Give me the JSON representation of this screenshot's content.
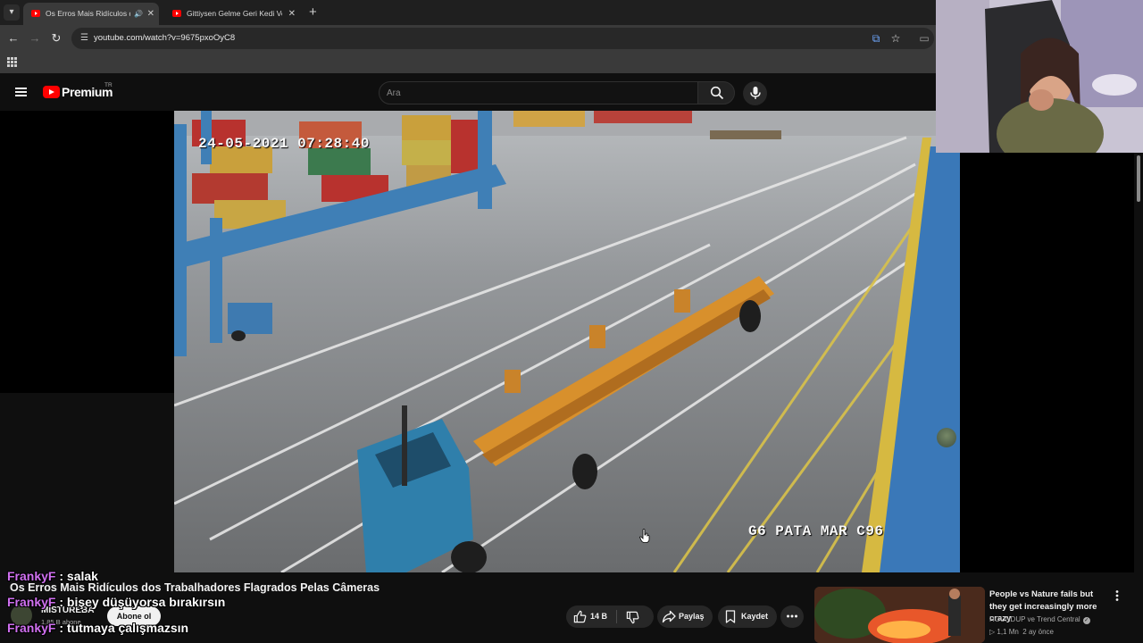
{
  "browser": {
    "tabs": [
      {
        "title": "Os Erros Mais Ridículos dos Trabalhadores",
        "active": true,
        "audio": true
      },
      {
        "title": "Gittiysen Gelme Geri Kedi Versiyon",
        "active": false,
        "audio": false
      }
    ],
    "url": "youtube.com/watch?v=9675pxoOyC8"
  },
  "youtube": {
    "brand": "Premium",
    "country": "TR",
    "search_placeholder": "Ara"
  },
  "video": {
    "overlay_timestamp": "24-05-2021 07:28:40",
    "overlay_camera_label": "G6 PATA MAR C96",
    "title": "Os Erros Mais Ridículos dos Trabalhadores Flagrados Pelas Câmeras",
    "channel_name": "MISTUREBA",
    "channel_subs": "1,85 B abone",
    "subscribe_label": "Abone ol",
    "likes": "14 B",
    "share_label": "Paylaş",
    "save_label": "Kaydet"
  },
  "chat": [
    {
      "user": "FrankyF",
      "message": "salak"
    },
    {
      "user": "FrankyF",
      "message": "bişey düşüyorsa bırakırsın"
    },
    {
      "user": "FrankyF",
      "message": "tutmaya çalışmazsın"
    }
  ],
  "recommended": {
    "title": "People vs Nature fails but they get increasingly more crazy",
    "channel": "ROUNDUP ve Trend Central",
    "views": "1,1 Mn",
    "age": "2 ay önce"
  },
  "colors": {
    "youtube_red": "#ff0000",
    "background": "#0f0f0f",
    "chat_username": "#d070f0"
  },
  "icons": [
    "tab-menu-icon",
    "back-icon",
    "forward-icon",
    "reload-icon",
    "site-info-icon",
    "translate-icon",
    "star-icon",
    "apps-icon",
    "hamburger-icon",
    "search-icon",
    "mic-icon",
    "like-icon",
    "dislike-icon",
    "share-icon",
    "save-icon",
    "more-icon"
  ]
}
